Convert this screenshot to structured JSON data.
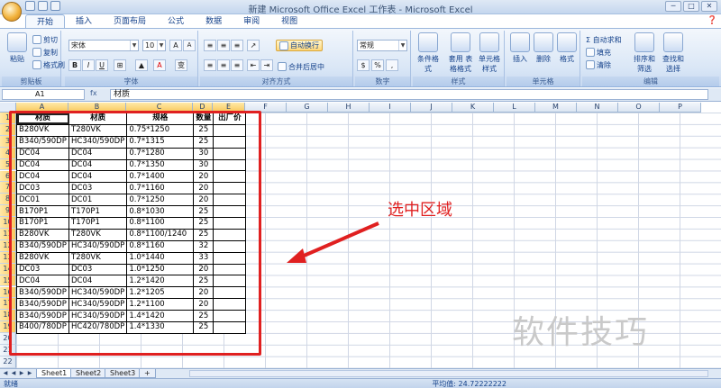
{
  "window": {
    "title": "新建 Microsoft Office Excel 工作表 - Microsoft Excel",
    "controls": [
      "─",
      "□",
      "✕"
    ]
  },
  "tabs": [
    "开始",
    "插入",
    "页面布局",
    "公式",
    "数据",
    "审阅",
    "视图"
  ],
  "active_tab": "开始",
  "ribbon": {
    "clipboard": {
      "paste": "粘贴",
      "cut": "剪切",
      "copy": "复制",
      "format_painter": "格式刷",
      "label": "剪贴板"
    },
    "font": {
      "name": "宋体",
      "size": "10",
      "grow": "A",
      "shrink": "A",
      "bold": "B",
      "italic": "I",
      "underline": "U",
      "font_color": "A",
      "phonetic": "变",
      "label": "字体"
    },
    "alignment": {
      "wrap": "自动换行",
      "merge": "合并后居中",
      "label": "对齐方式"
    },
    "number": {
      "format": "常规",
      "currency": "$",
      "percent": "%",
      "comma": ",",
      "label": "数字"
    },
    "styles": {
      "cond": "条件格式",
      "table": "套用\n表格格式",
      "cell": "单元格\n样式",
      "label": "样式"
    },
    "cells": {
      "insert": "插入",
      "delete": "删除",
      "format": "格式",
      "label": "单元格"
    },
    "editing": {
      "autosum": "Σ 自动求和",
      "fill": "填充",
      "clear": "清除",
      "sort": "排序和\n筛选",
      "find": "查找和\n选择",
      "label": "编辑"
    }
  },
  "formula_bar": {
    "name_box": "A1",
    "fx": "fx",
    "content": "材质"
  },
  "columns": [
    "A",
    "B",
    "C",
    "D",
    "E",
    "F",
    "G",
    "H",
    "I",
    "J",
    "K",
    "L",
    "M",
    "N",
    "O",
    "P"
  ],
  "rows": [
    "1",
    "2",
    "3",
    "4",
    "5",
    "6",
    "7",
    "8",
    "9",
    "10",
    "11",
    "12",
    "13",
    "14",
    "15",
    "16",
    "17",
    "18",
    "19",
    "20",
    "21",
    "22"
  ],
  "table": {
    "headers": [
      "材质",
      "材质",
      "规格",
      "数量",
      "出厂价"
    ],
    "rows": [
      [
        "B280VK",
        "T280VK",
        "0.75*1250",
        "25",
        ""
      ],
      [
        "B340/590DP",
        "HC340/590DP",
        "0.7*1315",
        "25",
        ""
      ],
      [
        "DC04",
        "DC04",
        "0.7*1280",
        "30",
        ""
      ],
      [
        "DC04",
        "DC04",
        "0.7*1350",
        "30",
        ""
      ],
      [
        "DC04",
        "DC04",
        "0.7*1400",
        "20",
        ""
      ],
      [
        "DC03",
        "DC03",
        "0.7*1160",
        "20",
        ""
      ],
      [
        "DC01",
        "DC01",
        "0.7*1250",
        "20",
        ""
      ],
      [
        "B170P1",
        "T170P1",
        "0.8*1030",
        "25",
        ""
      ],
      [
        "B170P1",
        "T170P1",
        "0.8*1100",
        "25",
        ""
      ],
      [
        "B280VK",
        "T280VK",
        "0.8*1100/1240",
        "25",
        ""
      ],
      [
        "B340/590DP",
        "HC340/590DP",
        "0.8*1160",
        "32",
        ""
      ],
      [
        "B280VK",
        "T280VK",
        "1.0*1440",
        "33",
        ""
      ],
      [
        "DC03",
        "DC03",
        "1.0*1250",
        "20",
        ""
      ],
      [
        "DC04",
        "DC04",
        "1.2*1420",
        "25",
        ""
      ],
      [
        "B340/590DP",
        "HC340/590DP",
        "1.2*1205",
        "20",
        ""
      ],
      [
        "B340/590DP",
        "HC340/590DP",
        "1.2*1100",
        "20",
        ""
      ],
      [
        "B340/590DP",
        "HC340/590DP",
        "1.4*1420",
        "25",
        ""
      ],
      [
        "B400/780DP",
        "HC420/780DP",
        "1.4*1330",
        "25",
        ""
      ]
    ]
  },
  "annotation": {
    "text": "选中区域",
    "color": "#e02020"
  },
  "watermark": "软件技巧",
  "sheets": [
    "Sheet1",
    "Sheet2",
    "Sheet3"
  ],
  "status": {
    "left": "就绪",
    "average": "平均值: 24.72222222"
  },
  "colors": {
    "accent": "#15428b",
    "ribbon": "#dbe6f5",
    "selection": "#f9c95e",
    "annotation": "#e02020"
  }
}
